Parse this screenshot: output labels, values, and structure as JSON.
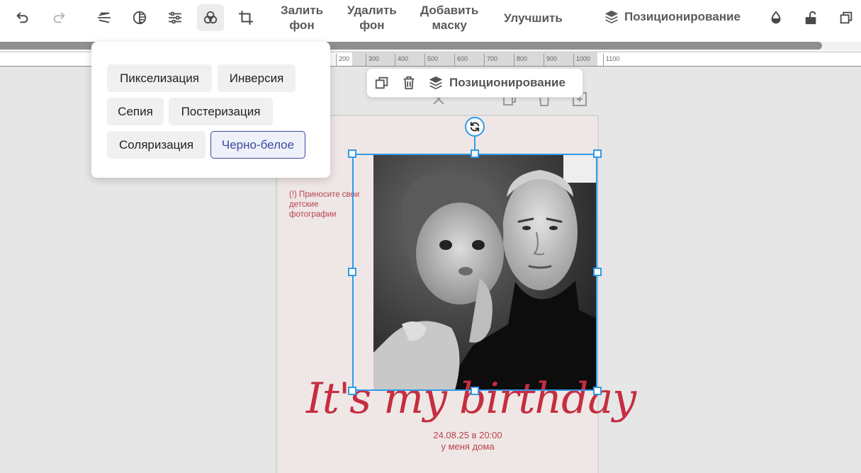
{
  "toolbar": {
    "fill_bg": [
      "Залить",
      "фон"
    ],
    "remove_bg": [
      "Удалить",
      "фон"
    ],
    "add_mask": [
      "Добавить",
      "маску"
    ],
    "enhance": "Улучшить",
    "positioning": "Позиционирование"
  },
  "ruler": {
    "ticks": [
      "200",
      "300",
      "400",
      "500",
      "600",
      "700",
      "800",
      "900",
      "1000",
      "1100"
    ]
  },
  "context_toolbar": {
    "positioning": "Позиционирование"
  },
  "filters": {
    "items": [
      "Пикселизация",
      "Инверсия",
      "Сепия",
      "Постеризация",
      "Соляризация",
      "Черно-белое"
    ],
    "selected": "Черно-белое"
  },
  "canvas": {
    "side_note": "(!) Приносите свои детские фотографии",
    "headline": "It's my birthday",
    "event_date": "24.08.25 в 20:00",
    "event_place": "у меня дома"
  },
  "colors": {
    "accent": "#c62d40",
    "selection": "#2f9be8",
    "chip_selected": "#3c4b9e"
  }
}
